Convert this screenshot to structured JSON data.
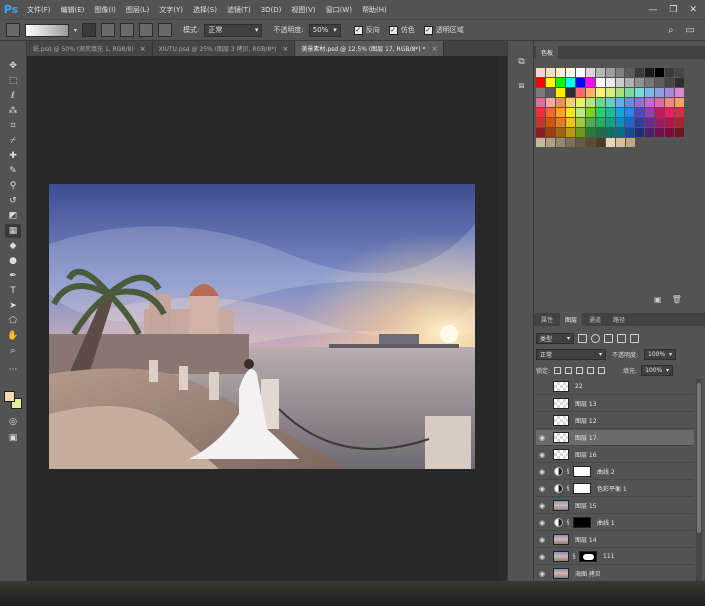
{
  "app": {
    "logo": "Ps"
  },
  "menu": [
    "文件(F)",
    "编辑(E)",
    "图像(I)",
    "图层(L)",
    "文字(Y)",
    "选择(S)",
    "滤镜(T)",
    "3D(D)",
    "视图(V)",
    "窗口(W)",
    "帮助(H)"
  ],
  "window_controls": {
    "minimize": "—",
    "restore": "❐",
    "close": "✕"
  },
  "options": {
    "mode_label": "模式:",
    "mode_value": "正常",
    "opacity_label": "不透明度:",
    "opacity_value": "50%",
    "reverse_label": "反向",
    "dither_label": "仿色",
    "transparency_label": "透明区域"
  },
  "tabs": [
    {
      "label": "纸.psd @ 50% (渐变填充 1, RGB/8)",
      "close": "×"
    },
    {
      "label": "XIUTU.psd @ 25% (图层 3 拷贝, RGB/8*)",
      "close": "×"
    },
    {
      "label": "美景素材.psd @ 12.5% (图层 17, RGB/8*) *",
      "close": "×"
    }
  ],
  "colors": {
    "foreground": "#efdcb0",
    "background": "#e4ef9a",
    "accent": "#31a8ff"
  },
  "swatches_panel": {
    "tab": "色板"
  },
  "swatch_rows": [
    [
      "#f2d9c1",
      "#f6ddc6",
      "#fff0cc",
      "#fffbe0",
      "#ffffff",
      "#d8d8d8",
      "#b8b8b8",
      "#9e9e9e",
      "#808080",
      "#5c5c5c",
      "#3b3b3b",
      "#1a1a1a",
      "#000000",
      "#3a3a3a",
      "#474747"
    ],
    [
      "#ff0000",
      "#ffff00",
      "#00ff00",
      "#00ffff",
      "#0000ff",
      "#ff00ff",
      "#ffffff",
      "#eaeaea",
      "#cccccc",
      "#b0b0b0",
      "#929292",
      "#777777",
      "#5e5e5e",
      "#464646",
      "#2e2e2e"
    ],
    [
      "#7a7a7a",
      "#5a5a5a",
      "#ffee00",
      "#303030",
      "#fe6a6a",
      "#ffb36a",
      "#fff27a",
      "#d4f07a",
      "#a7e07a",
      "#7ad7a0",
      "#7ad8d8",
      "#7ab8e8",
      "#8aa0e0",
      "#a68ad8",
      "#d88ad0"
    ],
    [
      "#e86a9a",
      "#f0aaa0",
      "#f48d60",
      "#ffd06a",
      "#e8f06a",
      "#b8e86a",
      "#6ad88a",
      "#60d0c8",
      "#60b0e8",
      "#6a88e0",
      "#9070d8",
      "#c06ad0",
      "#e06aa8",
      "#f08a7a",
      "#f4a060"
    ],
    [
      "#e8333a",
      "#ef6a2e",
      "#f5a623",
      "#f8e71c",
      "#b8e986",
      "#7ed321",
      "#2ecc71",
      "#1abc9c",
      "#16a5c8",
      "#2f80ed",
      "#4a4ab8",
      "#8e44ad",
      "#c2185b",
      "#e91e63",
      "#d0314a"
    ],
    [
      "#c0392b",
      "#d35400",
      "#e67e22",
      "#f1c40f",
      "#9ccc3c",
      "#4caf50",
      "#27ae60",
      "#16a085",
      "#0e8faf",
      "#1e66c7",
      "#2c3e9e",
      "#6a2c91",
      "#9b1b6a",
      "#b3124d",
      "#a8232f"
    ],
    [
      "#8b1e1e",
      "#9c3d0c",
      "#a8610f",
      "#b89a0a",
      "#6e9a20",
      "#2f7a32",
      "#1c6e44",
      "#0f6e5e",
      "#0b6b85",
      "#154c96",
      "#1f2c78",
      "#4c1f6e",
      "#71124e",
      "#7a0e36",
      "#6e1620"
    ],
    [
      "#c8b89a",
      "#b0a080",
      "#988868",
      "#807050",
      "#685a3e",
      "#5a4a30",
      "#4a3c26",
      "#e6d2b4",
      "#d8c0a0",
      "#c2a882"
    ]
  ],
  "swatch_footer": {
    "new": "▣",
    "delete": "🗑"
  },
  "layers_panel": {
    "tabs": [
      "属性",
      "图层",
      "通道",
      "路径"
    ],
    "filter_label": "类型",
    "blend_value": "正常",
    "opacity_label": "不透明度:",
    "opacity_value": "100%",
    "lock_label": "锁定:",
    "fill_label": "填充:",
    "fill_value": "100%",
    "layers": [
      {
        "name": "22",
        "visible": false,
        "thumb": "checker",
        "selected": false,
        "kind": "pixel"
      },
      {
        "name": "图层 13",
        "visible": false,
        "thumb": "checker",
        "selected": false,
        "kind": "pixel"
      },
      {
        "name": "图层 12",
        "visible": false,
        "thumb": "checker",
        "selected": false,
        "kind": "pixel"
      },
      {
        "name": "图层 17",
        "visible": true,
        "thumb": "checker",
        "selected": true,
        "kind": "pixel"
      },
      {
        "name": "图层 16",
        "visible": true,
        "thumb": "checker",
        "selected": false,
        "kind": "pixel"
      },
      {
        "name": "曲线 2",
        "visible": true,
        "thumb": "white",
        "selected": false,
        "kind": "adjustment",
        "mask": "white"
      },
      {
        "name": "色彩平衡 1",
        "visible": true,
        "thumb": "white",
        "selected": false,
        "kind": "adjustment",
        "mask": "white"
      },
      {
        "name": "图层 15",
        "visible": true,
        "thumb": "photo",
        "selected": false,
        "kind": "pixel"
      },
      {
        "name": "曲线 1",
        "visible": true,
        "thumb": "black",
        "selected": false,
        "kind": "adjustment",
        "mask": "black"
      },
      {
        "name": "图层 14",
        "visible": true,
        "thumb": "photo",
        "selected": false,
        "kind": "pixel"
      },
      {
        "name": "111",
        "visible": true,
        "thumb": "photo",
        "selected": false,
        "kind": "masked",
        "mask": "shape"
      },
      {
        "name": "海图 拷贝",
        "visible": true,
        "thumb": "photo",
        "selected": false,
        "kind": "pixel"
      }
    ]
  }
}
